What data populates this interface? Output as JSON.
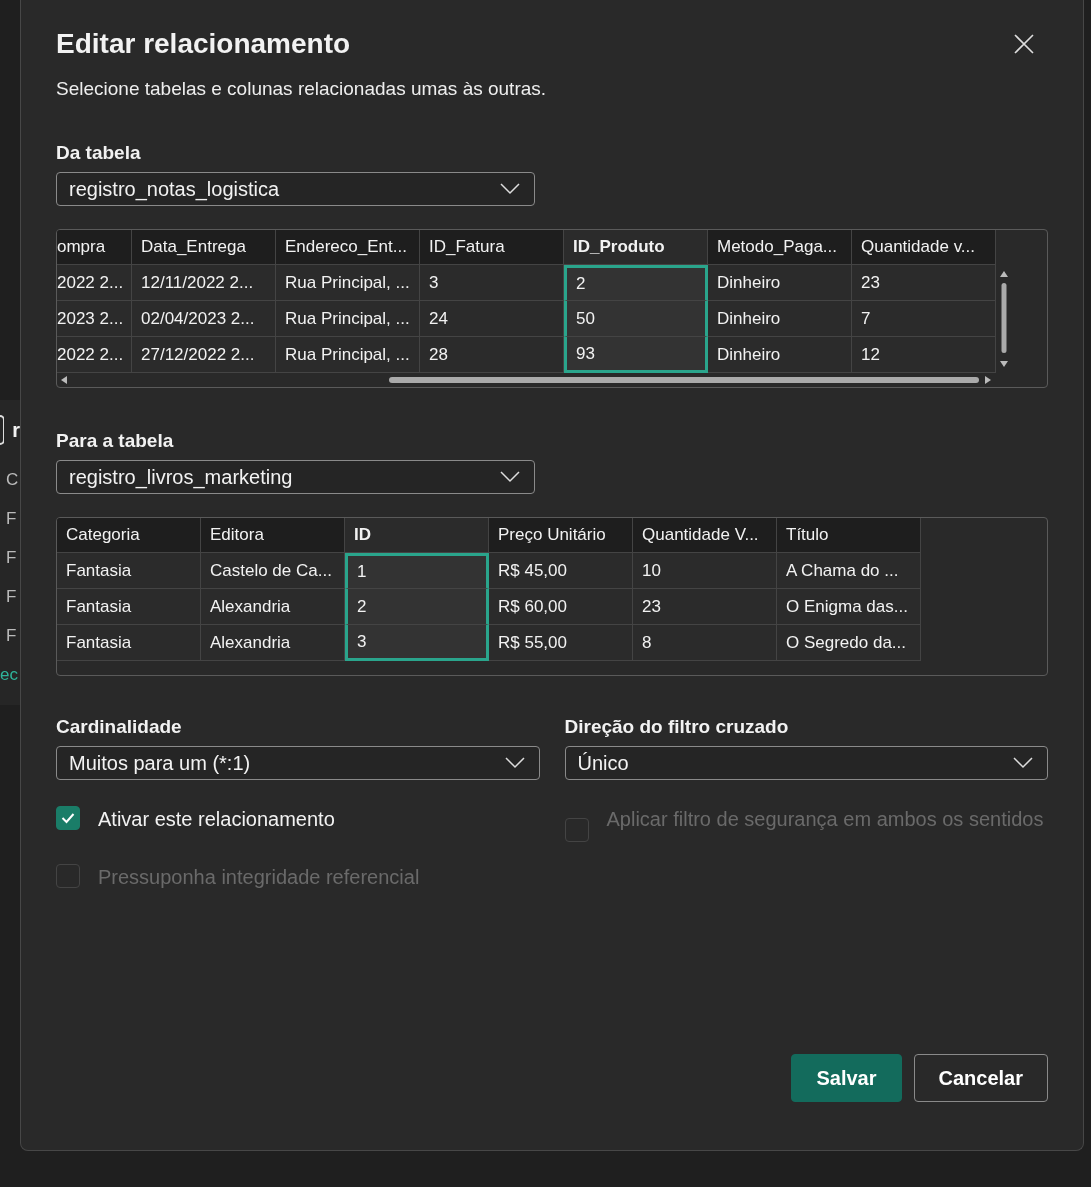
{
  "background_panel": {
    "heading": "r",
    "items": [
      {
        "label": "C",
        "kind": "plain"
      },
      {
        "label": "F",
        "kind": "plain"
      },
      {
        "label": "F",
        "kind": "plain"
      },
      {
        "label": "F",
        "kind": "plain"
      },
      {
        "label": "F",
        "kind": "plain"
      },
      {
        "label": "ec",
        "kind": "link"
      }
    ]
  },
  "dialog": {
    "title": "Editar relacionamento",
    "subtitle": "Selecione tabelas e colunas relacionadas umas às outras.",
    "from": {
      "label": "Da tabela",
      "value": "registro_notas_logistica",
      "columns": [
        {
          "label": "ompra",
          "selected": false,
          "kind": "partial"
        },
        {
          "label": "Data_Entrega",
          "selected": false
        },
        {
          "label": "Endereco_Ent...",
          "selected": false
        },
        {
          "label": "ID_Fatura",
          "selected": false
        },
        {
          "label": "ID_Produto",
          "selected": true
        },
        {
          "label": "Metodo_Paga...",
          "selected": false
        },
        {
          "label": "Quantidade v...",
          "selected": false
        }
      ],
      "rows": [
        [
          "2022 2...",
          "12/11/2022 2...",
          "Rua Principal, ...",
          "3",
          "2",
          "Dinheiro",
          "23"
        ],
        [
          "2023 2...",
          "02/04/2023 2...",
          "Rua Principal, ...",
          "24",
          "50",
          "Dinheiro",
          "7"
        ],
        [
          "2022 2...",
          "27/12/2022 2...",
          "Rua Principal, ...",
          "28",
          "93",
          "Dinheiro",
          "12"
        ]
      ]
    },
    "to": {
      "label": "Para a tabela",
      "value": "registro_livros_marketing",
      "columns": [
        {
          "label": "Categoria",
          "selected": false
        },
        {
          "label": "Editora",
          "selected": false
        },
        {
          "label": "ID",
          "selected": true
        },
        {
          "label": "Preço Unitário",
          "selected": false
        },
        {
          "label": "Quantidade V...",
          "selected": false
        },
        {
          "label": "Título",
          "selected": false
        }
      ],
      "rows": [
        [
          "Fantasia",
          "Castelo de Ca...",
          "1",
          "R$ 45,00",
          "10",
          "A Chama do ..."
        ],
        [
          "Fantasia",
          "Alexandria",
          "2",
          "R$ 60,00",
          "23",
          "O Enigma das..."
        ],
        [
          "Fantasia",
          "Alexandria",
          "3",
          "R$ 55,00",
          "8",
          "O Segredo da..."
        ]
      ]
    },
    "cardinality": {
      "label": "Cardinalidade",
      "value": "Muitos para um (*:1)"
    },
    "cross_filter": {
      "label": "Direção do filtro cruzado",
      "value": "Único"
    },
    "options": [
      {
        "label": "Ativar este relacionamento",
        "checked": true,
        "disabled": false
      },
      {
        "label": "Aplicar filtro de segurança em ambos os sentidos",
        "checked": false,
        "disabled": true
      },
      {
        "label": "Pressuponha integridade referencial",
        "checked": false,
        "disabled": true
      }
    ],
    "buttons": [
      {
        "label": "Salvar",
        "kind": "primary"
      },
      {
        "label": "Cancelar",
        "kind": "secondary"
      }
    ]
  }
}
